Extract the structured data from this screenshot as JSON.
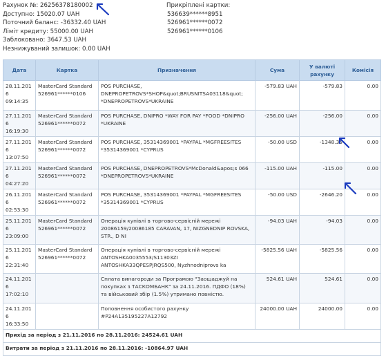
{
  "account": {
    "number": "Рахунок №: 26256378180002",
    "available": "Доступно: 15020.07 UAH",
    "current_balance": "Поточний баланс: -36332.40 UAH",
    "credit_limit": "Ліміт кредиту: 55000.00 UAH",
    "blocked": "Заблоковано: 3647.53 UAH",
    "min_balance": "Незнижуваний залишок: 0.00 UAH"
  },
  "attached_cards": {
    "title": "Прикріплені картки:",
    "cards": [
      "536639******8951",
      "526961******0072",
      "526961******0106"
    ]
  },
  "table": {
    "headers": [
      "Дата",
      "Картка",
      "Призначення",
      "Сума",
      "У валюті рахунку",
      "Комісія"
    ],
    "rows": [
      {
        "date": "28.11.2016",
        "time": "09:14:35",
        "card_type": "MasterCard Standard",
        "card_num": "526961******0106",
        "desc": "POS PURCHASE, DNEPROPETROVS*SHOP&quot;BRUSNITSA03118&quot; *DNEPROPETROVS*UKRAINE",
        "amount": "-579.83 UAH",
        "amount_acc": "-579.83",
        "commission": "0.00"
      },
      {
        "date": "27.11.2016",
        "time": "16:19:30",
        "card_type": "MasterCard Standard",
        "card_num": "526961******0072",
        "desc": "POS PURCHASE, DNIPRO *WAY FOR PAY *FOOD *DNIPRO *UKRAINE",
        "amount": "-256.00 UAH",
        "amount_acc": "-256.00",
        "commission": "0.00"
      },
      {
        "date": "27.11.2016",
        "time": "13:07:50",
        "card_type": "MasterCard Standard",
        "card_num": "526961******0072",
        "desc": "POS PURCHASE, 35314369001 *PAYPAL *MGFREESITES *35314369001 *CYPRUS",
        "amount": "-50.00 USD",
        "amount_acc": "-1348.35",
        "commission": "0.00"
      },
      {
        "date": "27.11.2016",
        "time": "04:27:20",
        "card_type": "MasterCard Standard",
        "card_num": "526961******0072",
        "desc": "POS PURCHASE, DNEPROPETROVS*McDonald&apos;s 066 *DNEPROPETROVS*UKRAINE",
        "amount": "-115.00 UAH",
        "amount_acc": "-115.00",
        "commission": "0.00"
      },
      {
        "date": "26.11.2016",
        "time": "02:53:30",
        "card_type": "MasterCard Standard",
        "card_num": "526961******0072",
        "desc": "POS PURCHASE, 35314369001 *PAYPAL *MGFREESITES *35314369001 *CYPRUS",
        "amount": "-50.00 USD",
        "amount_acc": "-2646.20",
        "commission": "0.00"
      },
      {
        "date": "25.11.2016",
        "time": "23:09:00",
        "card_type": "MasterCard Standard",
        "card_num": "526961******0072",
        "desc": "Операція купівлі в торгово-сервісній мережі 20086159/20086185 CARAVAN, 17, NIZGNEDNIP ROVSKA, STR., D NI",
        "amount": "-94.03 UAH",
        "amount_acc": "-94.03",
        "commission": "0.00"
      },
      {
        "date": "25.11.2016",
        "time": "22:31:40",
        "card_type": "MasterCard Standard",
        "card_num": "526961******0072",
        "desc": "Операція купівлі в торгово-сервісній мережі ANTOSHKA0035553/S11303ZI ANTOSHKA33QPESPJRQS500, Nyzhnodniprovs ka",
        "amount": "-5825.56 UAH",
        "amount_acc": "-5825.56",
        "commission": "0.00"
      },
      {
        "date": "24.11.2016",
        "time": "17:02:10",
        "card_type": "",
        "card_num": "",
        "desc": "Сплата винагороди за Програмою \"Заощаджуй на покупках з ТАСКОМБАНК\" за 24.11.2016. ПДФО (18%) та військовий збір (1.5%) утримано повністю.",
        "amount": "524.61 UAH",
        "amount_acc": "524.61",
        "commission": "0.00"
      },
      {
        "date": "24.11.2016",
        "time": "16:33:50",
        "card_type": "",
        "card_num": "",
        "desc": "Поповнення особистого рахунку #P24A135195227A12792",
        "amount": "24000.00 UAH",
        "amount_acc": "24000.00",
        "commission": "0.00"
      }
    ],
    "income": "Прихід за період з 21.11.2016 по 28.11.2016:  24524.61 UAH",
    "expense": "Витрати за період з 21.11.2016 по 28.11.2016:  -10864.97 UAH"
  },
  "colors": {
    "header_bg": "#c9dcf0",
    "header_text": "#2f5f97",
    "annotation": "#1a3bbf",
    "row_alt": "#f4f7fb"
  }
}
